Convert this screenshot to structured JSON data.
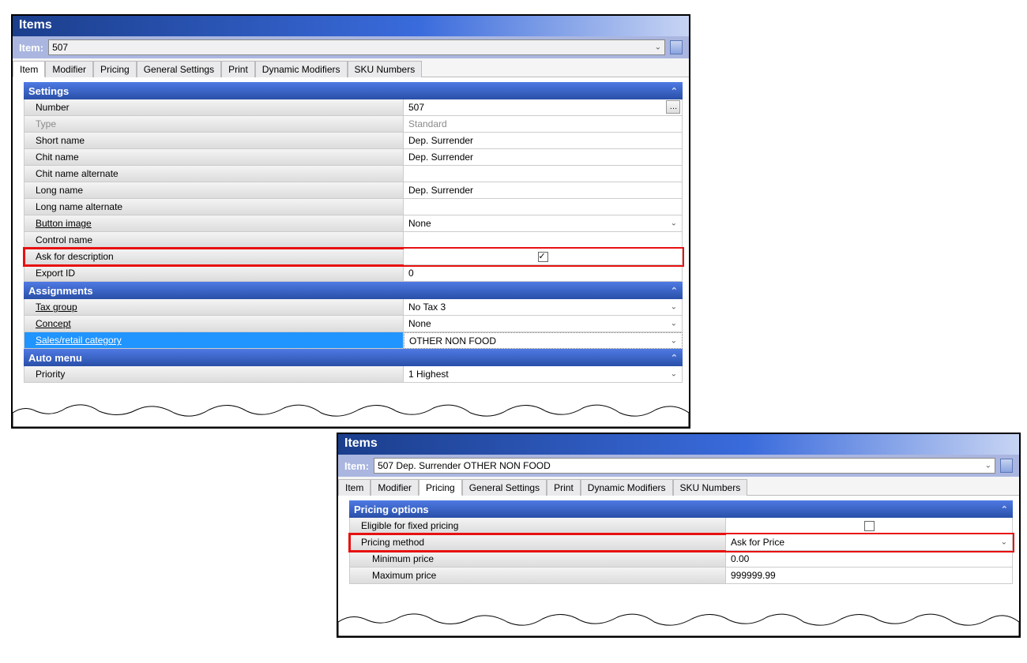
{
  "window1": {
    "title": "Items",
    "item_label": "Item:",
    "item_value": "507",
    "tabs": [
      "Item",
      "Modifier",
      "Pricing",
      "General Settings",
      "Print",
      "Dynamic Modifiers",
      "SKU Numbers"
    ],
    "active_tab": 0,
    "sections": {
      "settings": {
        "header": "Settings",
        "rows": {
          "number": {
            "label": "Number",
            "value": "507"
          },
          "type": {
            "label": "Type",
            "value": "Standard"
          },
          "short_name": {
            "label": "Short name",
            "value": "Dep. Surrender"
          },
          "chit_name": {
            "label": "Chit name",
            "value": "Dep. Surrender"
          },
          "chit_name_alt": {
            "label": "Chit name alternate",
            "value": ""
          },
          "long_name": {
            "label": "Long name",
            "value": "Dep. Surrender"
          },
          "long_name_alt": {
            "label": "Long name alternate",
            "value": ""
          },
          "button_image": {
            "label": "Button image",
            "value": "None"
          },
          "control_name": {
            "label": "Control name",
            "value": ""
          },
          "ask_desc": {
            "label": "Ask for description",
            "checked": true
          },
          "export_id": {
            "label": "Export ID",
            "value": "0"
          }
        }
      },
      "assignments": {
        "header": "Assignments",
        "rows": {
          "tax_group": {
            "label": "Tax group",
            "value": "No Tax 3"
          },
          "concept": {
            "label": "Concept",
            "value": "None"
          },
          "sales_retail": {
            "label": "Sales/retail category",
            "value": "OTHER NON FOOD"
          }
        }
      },
      "automenu": {
        "header": "Auto menu",
        "rows": {
          "priority": {
            "label": "Priority",
            "value": "1 Highest"
          }
        }
      }
    }
  },
  "window2": {
    "title": "Items",
    "item_label": "Item:",
    "item_value": "507 Dep. Surrender OTHER NON FOOD",
    "tabs": [
      "Item",
      "Modifier",
      "Pricing",
      "General Settings",
      "Print",
      "Dynamic Modifiers",
      "SKU Numbers"
    ],
    "active_tab": 2,
    "sections": {
      "pricing_options": {
        "header": "Pricing options",
        "rows": {
          "eligible_fixed": {
            "label": "Eligible for fixed pricing",
            "checked": false
          },
          "pricing_method": {
            "label": "Pricing method",
            "value": "Ask for Price"
          },
          "min_price": {
            "label": "Minimum price",
            "value": "0.00"
          },
          "max_price": {
            "label": "Maximum price",
            "value": "999999.99"
          }
        }
      }
    }
  }
}
